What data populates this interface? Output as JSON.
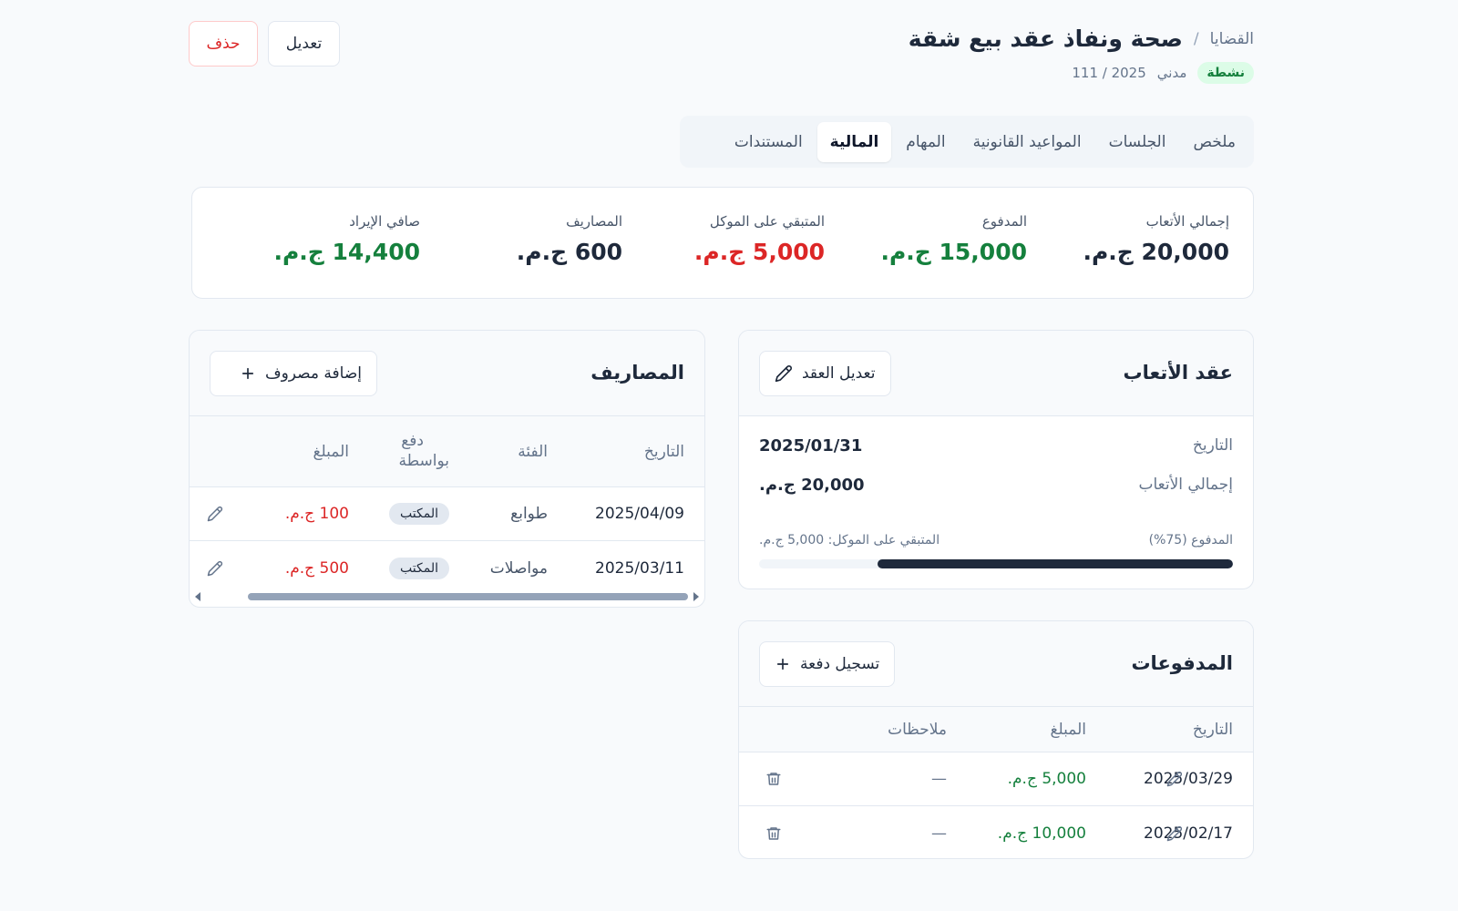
{
  "breadcrumb": {
    "parent": "القضايا",
    "separator": "/",
    "title": "صحة ونفاذ عقد بيع شقة"
  },
  "case_meta": {
    "status": "نشطة",
    "type": "مدني",
    "number": "111 / 2025"
  },
  "actions": {
    "edit": "تعديل",
    "delete": "حذف"
  },
  "tabs": [
    {
      "label": "ملخص",
      "active": false
    },
    {
      "label": "الجلسات",
      "active": false
    },
    {
      "label": "المواعيد القانونية",
      "active": false
    },
    {
      "label": "المهام",
      "active": false
    },
    {
      "label": "المالية",
      "active": true
    },
    {
      "label": "المستندات",
      "active": false
    }
  ],
  "summary": [
    {
      "label": "إجمالي الأتعاب",
      "value": "20,000 ج.م.",
      "color": "#1e293b"
    },
    {
      "label": "المدفوع",
      "value": "15,000 ج.م.",
      "color": "#15803d"
    },
    {
      "label": "المتبقي على الموكل",
      "value": "5,000 ج.م.",
      "color": "#dc2626"
    },
    {
      "label": "المصاريف",
      "value": "600 ج.م.",
      "color": "#1e293b"
    },
    {
      "label": "صافي الإيراد",
      "value": "14,400 ج.م.",
      "color": "#15803d"
    }
  ],
  "fee_contract": {
    "title": "عقد الأتعاب",
    "edit_button": "تعديل العقد",
    "date_label": "التاريخ",
    "date_value": "2025/01/31",
    "total_label": "إجمالي الأتعاب",
    "total_value": "20,000 ج.م.",
    "paid_label": "المدفوع (75%)",
    "remaining_label": "المتبقي على الموكل: 5,000 ج.م.",
    "progress_percent": 75
  },
  "payments": {
    "title": "المدفوعات",
    "add_button": "تسجيل دفعة",
    "columns": {
      "date": "التاريخ",
      "amount": "المبلغ",
      "notes": "ملاحظات"
    },
    "rows": [
      {
        "date": "2025/03/29",
        "amount": "5,000 ج.م.",
        "notes": "—"
      },
      {
        "date": "2025/02/17",
        "amount": "10,000 ج.م.",
        "notes": "—"
      }
    ]
  },
  "expenses": {
    "title": "المصاريف",
    "add_button": "إضافة مصروف",
    "columns": {
      "date": "التاريخ",
      "category": "الفئة",
      "paid_by_line1": "دفع",
      "paid_by_line2": "بواسطة",
      "amount": "المبلغ"
    },
    "rows": [
      {
        "date": "2025/04/09",
        "category": "طوابع",
        "paid_by": "المكتب",
        "amount": "100 ج.م."
      },
      {
        "date": "2025/03/11",
        "category": "مواصلات",
        "paid_by": "المكتب",
        "amount": "500 ج.م."
      }
    ]
  }
}
